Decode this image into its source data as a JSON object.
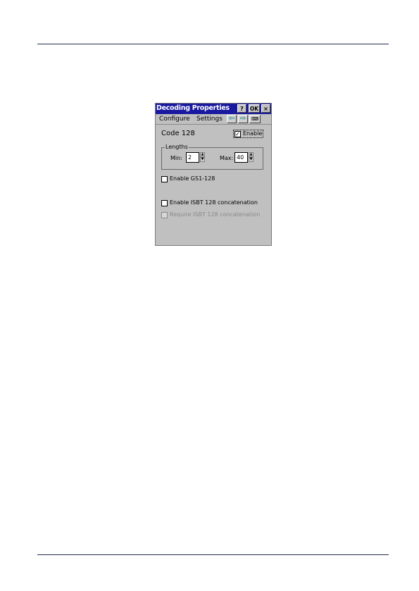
{
  "window": {
    "title": "Decoding Properties",
    "help_label": "?",
    "ok_label": "OK",
    "close_label": "×"
  },
  "menu": {
    "configure": "Configure",
    "settings": "Settings",
    "back_glyph": "⇦",
    "forward_glyph": "⇨",
    "keyboard_glyph": "⌨"
  },
  "panel": {
    "symbology": "Code 128",
    "enable_label": "Enable",
    "enable_checked": true,
    "lengths": {
      "legend": "Lengths",
      "min_label": "Min:",
      "min_value": "2",
      "max_label": "Max:",
      "max_value": "40"
    },
    "gs1_label": "Enable GS1-128",
    "isbt_label": "Enable ISBT 128 concatenation",
    "require_isbt_label": "Require ISBT 128 concatenation"
  },
  "icons": {
    "check": "✓",
    "spin_up": "▲",
    "spin_down": "▼"
  },
  "colors": {
    "titlebar": "#1a1aa0",
    "dialog_bg": "#c0c0c0",
    "nav_arrow": "#008080",
    "disabled_text": "#8a8a8a"
  }
}
